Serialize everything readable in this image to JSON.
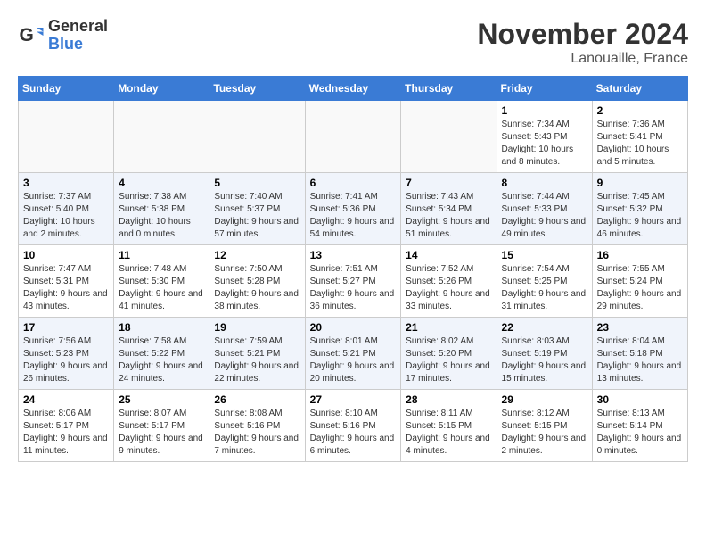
{
  "header": {
    "logo_general": "General",
    "logo_blue": "Blue",
    "month_title": "November 2024",
    "location": "Lanouaille, France"
  },
  "weekdays": [
    "Sunday",
    "Monday",
    "Tuesday",
    "Wednesday",
    "Thursday",
    "Friday",
    "Saturday"
  ],
  "weeks": [
    [
      {
        "day": "",
        "info": ""
      },
      {
        "day": "",
        "info": ""
      },
      {
        "day": "",
        "info": ""
      },
      {
        "day": "",
        "info": ""
      },
      {
        "day": "",
        "info": ""
      },
      {
        "day": "1",
        "info": "Sunrise: 7:34 AM\nSunset: 5:43 PM\nDaylight: 10 hours and 8 minutes."
      },
      {
        "day": "2",
        "info": "Sunrise: 7:36 AM\nSunset: 5:41 PM\nDaylight: 10 hours and 5 minutes."
      }
    ],
    [
      {
        "day": "3",
        "info": "Sunrise: 7:37 AM\nSunset: 5:40 PM\nDaylight: 10 hours and 2 minutes."
      },
      {
        "day": "4",
        "info": "Sunrise: 7:38 AM\nSunset: 5:38 PM\nDaylight: 10 hours and 0 minutes."
      },
      {
        "day": "5",
        "info": "Sunrise: 7:40 AM\nSunset: 5:37 PM\nDaylight: 9 hours and 57 minutes."
      },
      {
        "day": "6",
        "info": "Sunrise: 7:41 AM\nSunset: 5:36 PM\nDaylight: 9 hours and 54 minutes."
      },
      {
        "day": "7",
        "info": "Sunrise: 7:43 AM\nSunset: 5:34 PM\nDaylight: 9 hours and 51 minutes."
      },
      {
        "day": "8",
        "info": "Sunrise: 7:44 AM\nSunset: 5:33 PM\nDaylight: 9 hours and 49 minutes."
      },
      {
        "day": "9",
        "info": "Sunrise: 7:45 AM\nSunset: 5:32 PM\nDaylight: 9 hours and 46 minutes."
      }
    ],
    [
      {
        "day": "10",
        "info": "Sunrise: 7:47 AM\nSunset: 5:31 PM\nDaylight: 9 hours and 43 minutes."
      },
      {
        "day": "11",
        "info": "Sunrise: 7:48 AM\nSunset: 5:30 PM\nDaylight: 9 hours and 41 minutes."
      },
      {
        "day": "12",
        "info": "Sunrise: 7:50 AM\nSunset: 5:28 PM\nDaylight: 9 hours and 38 minutes."
      },
      {
        "day": "13",
        "info": "Sunrise: 7:51 AM\nSunset: 5:27 PM\nDaylight: 9 hours and 36 minutes."
      },
      {
        "day": "14",
        "info": "Sunrise: 7:52 AM\nSunset: 5:26 PM\nDaylight: 9 hours and 33 minutes."
      },
      {
        "day": "15",
        "info": "Sunrise: 7:54 AM\nSunset: 5:25 PM\nDaylight: 9 hours and 31 minutes."
      },
      {
        "day": "16",
        "info": "Sunrise: 7:55 AM\nSunset: 5:24 PM\nDaylight: 9 hours and 29 minutes."
      }
    ],
    [
      {
        "day": "17",
        "info": "Sunrise: 7:56 AM\nSunset: 5:23 PM\nDaylight: 9 hours and 26 minutes."
      },
      {
        "day": "18",
        "info": "Sunrise: 7:58 AM\nSunset: 5:22 PM\nDaylight: 9 hours and 24 minutes."
      },
      {
        "day": "19",
        "info": "Sunrise: 7:59 AM\nSunset: 5:21 PM\nDaylight: 9 hours and 22 minutes."
      },
      {
        "day": "20",
        "info": "Sunrise: 8:01 AM\nSunset: 5:21 PM\nDaylight: 9 hours and 20 minutes."
      },
      {
        "day": "21",
        "info": "Sunrise: 8:02 AM\nSunset: 5:20 PM\nDaylight: 9 hours and 17 minutes."
      },
      {
        "day": "22",
        "info": "Sunrise: 8:03 AM\nSunset: 5:19 PM\nDaylight: 9 hours and 15 minutes."
      },
      {
        "day": "23",
        "info": "Sunrise: 8:04 AM\nSunset: 5:18 PM\nDaylight: 9 hours and 13 minutes."
      }
    ],
    [
      {
        "day": "24",
        "info": "Sunrise: 8:06 AM\nSunset: 5:17 PM\nDaylight: 9 hours and 11 minutes."
      },
      {
        "day": "25",
        "info": "Sunrise: 8:07 AM\nSunset: 5:17 PM\nDaylight: 9 hours and 9 minutes."
      },
      {
        "day": "26",
        "info": "Sunrise: 8:08 AM\nSunset: 5:16 PM\nDaylight: 9 hours and 7 minutes."
      },
      {
        "day": "27",
        "info": "Sunrise: 8:10 AM\nSunset: 5:16 PM\nDaylight: 9 hours and 6 minutes."
      },
      {
        "day": "28",
        "info": "Sunrise: 8:11 AM\nSunset: 5:15 PM\nDaylight: 9 hours and 4 minutes."
      },
      {
        "day": "29",
        "info": "Sunrise: 8:12 AM\nSunset: 5:15 PM\nDaylight: 9 hours and 2 minutes."
      },
      {
        "day": "30",
        "info": "Sunrise: 8:13 AM\nSunset: 5:14 PM\nDaylight: 9 hours and 0 minutes."
      }
    ]
  ]
}
